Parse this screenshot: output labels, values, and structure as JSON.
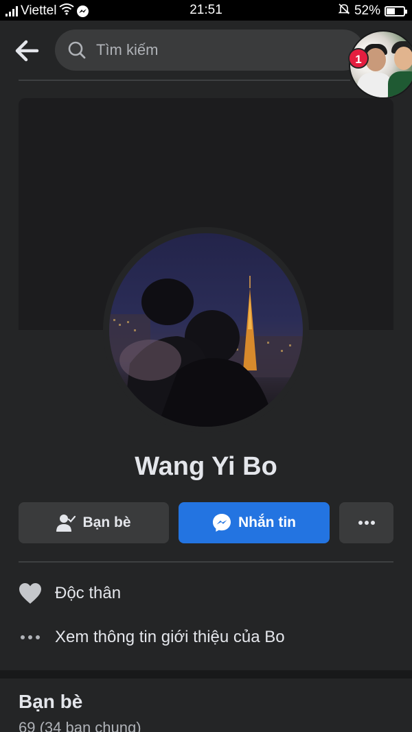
{
  "status_bar": {
    "carrier": "Viettel",
    "time": "21:51",
    "battery_percent": "52%",
    "battery_level": 0.52
  },
  "header": {
    "search_placeholder": "Tìm kiếm",
    "chat_head_badge": "1"
  },
  "profile": {
    "name": "Wang Yi Bo"
  },
  "actions": {
    "friends_label": "Bạn bè",
    "message_label": "Nhắn tin"
  },
  "info": {
    "relationship": "Độc thân",
    "see_about": "Xem thông tin giới thiệu của Bo"
  },
  "friends_section": {
    "title": "Bạn bè",
    "count": "69 (34 bạn chung)"
  },
  "colors": {
    "background": "#242526",
    "accent": "#2374e1",
    "badge": "#e41e3f"
  }
}
